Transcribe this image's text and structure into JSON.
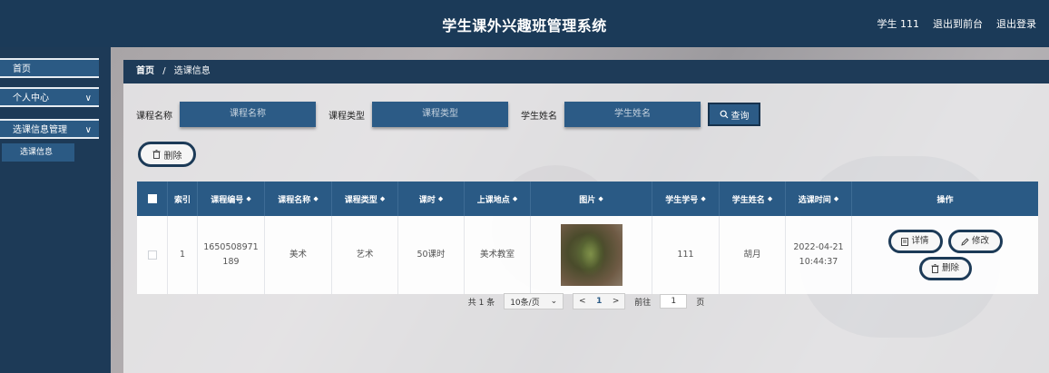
{
  "header": {
    "title": "学生课外兴趣班管理系统",
    "user_label": "学生 111",
    "back_front": "退出到前台",
    "logout": "退出登录"
  },
  "sidebar": {
    "items": [
      {
        "label": "首页"
      },
      {
        "label": "个人中心",
        "arrow": "∨"
      },
      {
        "label": "选课信息管理",
        "arrow": "∨"
      }
    ],
    "sub_items": [
      {
        "label": "选课信息"
      }
    ]
  },
  "breadcrumb": {
    "home": "首页",
    "sep": "/",
    "current": "选课信息"
  },
  "search": {
    "course_name_label": "课程名称",
    "course_name_placeholder": "课程名称",
    "course_type_label": "课程类型",
    "course_type_placeholder": "课程类型",
    "student_name_label": "学生姓名",
    "student_name_placeholder": "学生姓名",
    "query_label": "查询"
  },
  "toolbar": {
    "delete_label": "删除"
  },
  "table": {
    "headers": [
      "",
      "索引",
      "课程编号",
      "课程名称",
      "课程类型",
      "课时",
      "上课地点",
      "图片",
      "学生学号",
      "学生姓名",
      "选课时间",
      "操作"
    ],
    "rows": [
      {
        "index": "1",
        "course_no_line1": "1650508971",
        "course_no_line2": "189",
        "course_name": "美术",
        "course_type": "艺术",
        "hours": "50课时",
        "location": "美术教室",
        "student_no": "111",
        "student_name": "胡月",
        "time_line1": "2022-04-21",
        "time_line2": "10:44:37",
        "detail_label": "详情",
        "edit_label": "修改",
        "delete_label": "删除"
      }
    ]
  },
  "pagination": {
    "total": "共 1 条",
    "page_size": "10条/页",
    "prev": "<",
    "current": "1",
    "next": ">",
    "goto_label": "前往",
    "goto_value": "1",
    "page_unit": "页"
  },
  "colors": {
    "header_bg": "#1b3a58",
    "accent": "#2a5a85"
  }
}
